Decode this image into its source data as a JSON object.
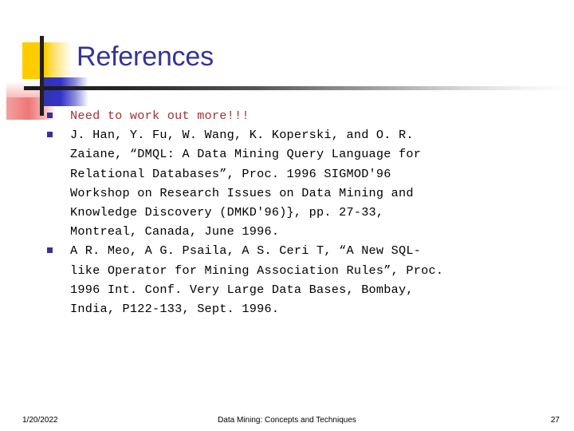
{
  "slide": {
    "title": "References",
    "title_color": "#333399",
    "bullet_color": "#333399",
    "accent_text_color": "#A03232",
    "background_color": "#FFFFFF"
  },
  "decoration": {
    "yellow_color": "#FFCC00",
    "blue_color": "#3333CC",
    "red_color": "#EE7777",
    "line_color": "#231F20"
  },
  "bullets": [
    {
      "marker": "square-bullet",
      "style": "accent",
      "text": "Need to work out more!!!"
    },
    {
      "marker": "square-bullet",
      "style": "normal",
      "text": "J. Han, Y. Fu, W. Wang, K. Koperski, and O. R.\nZaiane, “DMQL: A Data Mining Query Language for\nRelational Databases”, Proc. 1996 SIGMOD'96\nWorkshop on Research Issues on Data Mining and\nKnowledge Discovery (DMKD'96)}, pp. 27-33,\nMontreal, Canada, June 1996."
    },
    {
      "marker": "square-bullet",
      "style": "normal",
      "text": "A R. Meo, A G. Psaila, A S. Ceri T, “A New SQL-\nlike Operator for Mining Association Rules”, Proc.\n1996 Int. Conf. Very Large Data Bases, Bombay,\nIndia, P122-133, Sept. 1996."
    }
  ],
  "footer": {
    "date": "1/20/2022",
    "title": "Data Mining: Concepts and Techniques",
    "page_number": "27"
  }
}
